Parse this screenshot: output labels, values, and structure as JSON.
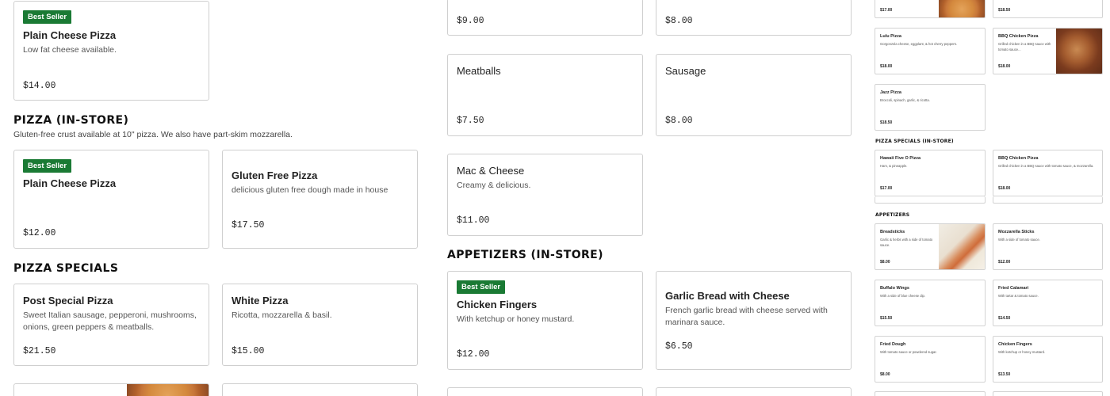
{
  "left": {
    "top_card": {
      "badge": "Best Seller",
      "name": "Plain Cheese Pizza",
      "desc": "Low fat cheese available.",
      "price": "$14.00"
    },
    "in_store": {
      "title": "PIZZA (IN-STORE)",
      "subtitle": "Gluten-free crust available at 10\" pizza. We also have part-skim mozzarella.",
      "items": [
        {
          "badge": "Best Seller",
          "name": "Plain Cheese Pizza",
          "desc": "",
          "price": "$12.00"
        },
        {
          "name": "Gluten Free Pizza",
          "desc": "delicious gluten free dough made in house",
          "price": "$17.50"
        }
      ]
    },
    "specials": {
      "title": "PIZZA SPECIALS",
      "items": [
        {
          "name": "Post Special Pizza",
          "desc": "Sweet Italian sausage, pepperoni, mushrooms, onions, green peppers & meatballs.",
          "price": "$21.50"
        },
        {
          "name": "White Pizza",
          "desc": "Ricotta, mozzarella & basil.",
          "price": "$15.00"
        }
      ]
    }
  },
  "middle": {
    "toppings": [
      {
        "name": "",
        "price": "$9.00"
      },
      {
        "name": "",
        "price": "$8.00"
      },
      {
        "name": "Meatballs",
        "price": "$7.50"
      },
      {
        "name": "Sausage",
        "price": "$8.00"
      },
      {
        "name": "Mac & Cheese",
        "desc": "Creamy & delicious.",
        "price": "$11.00"
      }
    ],
    "appetizers": {
      "title": "APPETIZERS (IN-STORE)",
      "items": [
        {
          "badge": "Best Seller",
          "name": "Chicken Fingers",
          "desc": "With ketchup or honey mustard.",
          "price": "$12.00"
        },
        {
          "name": "Garlic Bread with Cheese",
          "desc": "French garlic bread with cheese served with marinara sauce.",
          "price": "$6.50"
        }
      ]
    }
  },
  "right": {
    "top": [
      {
        "name": "",
        "desc": "",
        "price": "$17.00"
      },
      {
        "name": "",
        "desc": "",
        "price": "$18.50"
      },
      {
        "name": "Lulu Pizza",
        "desc": "Gorgonzola cheese, eggplant, & hot cherry peppers.",
        "price": "$18.00"
      },
      {
        "name": "BBQ Chicken Pizza",
        "desc": "Grilled chicken in a BBQ sauce with tomato sauce...",
        "price": "$18.00"
      },
      {
        "name": "Jazz Pizza",
        "desc": "Broccoli, spinach, garlic, & ricotta.",
        "price": "$18.50"
      }
    ],
    "specials_title": "PIZZA SPECIALS (IN-STORE)",
    "specials": [
      {
        "name": "Hawaii Five O Pizza",
        "desc": "Ham, & pineapple.",
        "price": "$17.00"
      },
      {
        "name": "BBQ Chicken Pizza",
        "desc": "Grilled chicken in a BBQ sauce with tomato sauce, & mozzarella.",
        "price": "$18.00"
      }
    ],
    "appetizers_title": "APPETIZERS",
    "appetizers": [
      {
        "name": "Breadsticks",
        "desc": "Garlic & herbs with a side of tomato sauce.",
        "price": "$8.00"
      },
      {
        "name": "Mozzarella Sticks",
        "desc": "With a side of tomato sauce.",
        "price": "$12.00"
      },
      {
        "name": "Buffalo Wings",
        "desc": "With a side of blue cheese dip.",
        "price": "$15.50"
      },
      {
        "name": "Fried Calamari",
        "desc": "With tartar & tomato sauce.",
        "price": "$14.50"
      },
      {
        "name": "Fried Dough",
        "desc": "With tomato sauce or powdered sugar.",
        "price": "$8.00"
      },
      {
        "name": "Chicken Fingers",
        "desc": "With ketchup or honey mustard.",
        "price": "$13.50"
      }
    ]
  }
}
